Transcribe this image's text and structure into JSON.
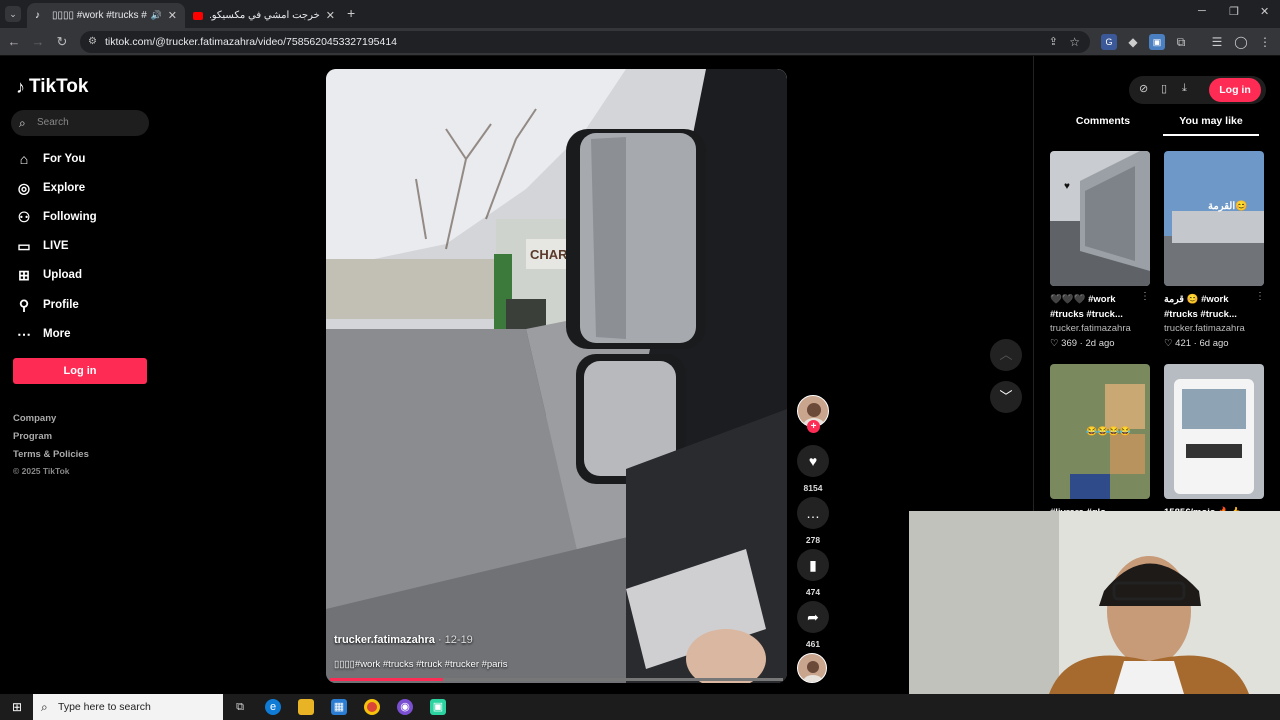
{
  "browser": {
    "tabs": [
      {
        "title": "▯▯▯▯ #work #trucks #truck",
        "active": true
      },
      {
        "title": "خرجت أمشي في مكسيكو... وتعرّ",
        "active": false
      }
    ],
    "url": "tiktok.com/@trucker.fatimazahra/video/7585620453327195414"
  },
  "sidebar": {
    "logo": "TikTok",
    "search_placeholder": "Search",
    "nav": [
      {
        "label": "For You",
        "icon": "home-icon"
      },
      {
        "label": "Explore",
        "icon": "compass-icon"
      },
      {
        "label": "Following",
        "icon": "user-icon"
      },
      {
        "label": "LIVE",
        "icon": "live-icon"
      },
      {
        "label": "Upload",
        "icon": "upload-icon"
      },
      {
        "label": "Profile",
        "icon": "profile-icon"
      },
      {
        "label": "More",
        "icon": "more-icon"
      }
    ],
    "login_label": "Log in",
    "footer": [
      "Company",
      "Program",
      "Terms & Policies",
      "© 2025 TikTok"
    ]
  },
  "video": {
    "username": "trucker.fatimazahra",
    "date": " · 12-19",
    "caption": "▯▯▯▯#work #trucks #truck #trucker #paris",
    "progress": 0.25,
    "sign_text": "CHARBO"
  },
  "actions": {
    "likes": "8154",
    "comments": "278",
    "saves": "474",
    "shares": "461"
  },
  "right_panel": {
    "login_label": "Log in",
    "tabs": [
      "Comments",
      "You may like"
    ],
    "active_tab": "You may like",
    "cards": [
      {
        "title": "🖤🖤🖤 #work #trucks #truck...",
        "user": "trucker.fatimazahra",
        "likes": "369",
        "age": "2d ago"
      },
      {
        "title": "قرمة 😊 #work #trucks #truck...",
        "user": "trucker.fatimazahra",
        "likes": "421",
        "age": "6d ago",
        "overlay": "القرمة😊"
      },
      {
        "title": "#livrere #glo...",
        "overlay": "😂😂😂😂"
      },
      {
        "title": "1585€/mois 🔥👍"
      }
    ]
  },
  "taskbar": {
    "search_placeholder": "Type here to search"
  },
  "colors": {
    "accent": "#fe2c55",
    "background": "#000000"
  }
}
